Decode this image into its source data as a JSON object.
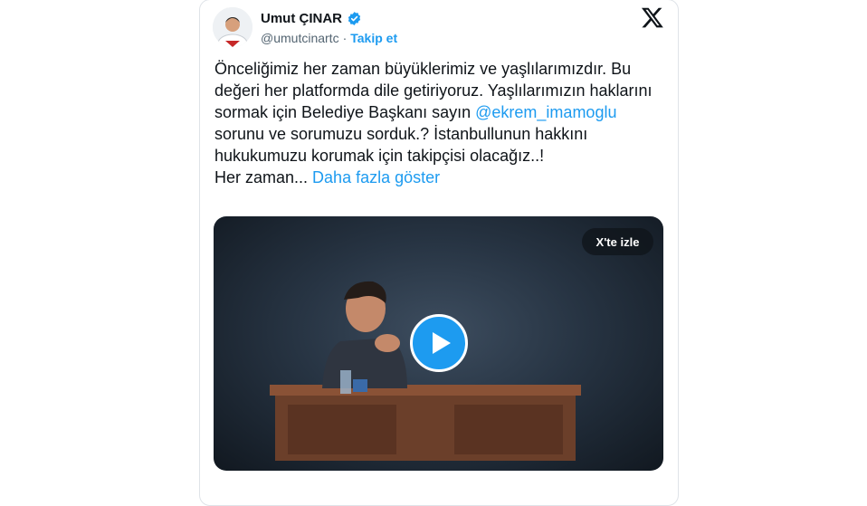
{
  "author": {
    "name": "Umut ÇINAR",
    "handle": "@umutcinartc",
    "separator": "·",
    "follow_label": "Takip et"
  },
  "tweet": {
    "text_before_mention": "Önceliğimiz her zaman büyüklerimiz ve yaşlılarımızdır. Bu değeri her platformda dile getiriyoruz. Yaşlılarımızın haklarını sormak için Belediye Başkanı sayın ",
    "mention": "@ekrem_imamoglu",
    "text_after_mention": " sorunu ve sorumuzu sorduk.? İstanbullunun hakkını hukukumuzu korumak için takipçisi olacağız..!",
    "truncated_line": "Her zaman... ",
    "show_more_label": "Daha fazla göster"
  },
  "media": {
    "watch_on_x_label": "X'te izle"
  },
  "colors": {
    "accent": "#1d9bf0",
    "text": "#0f1419",
    "muted": "#536471"
  },
  "icons": {
    "verified": "verified-badge-icon",
    "logo": "x-logo-icon",
    "play": "play-icon"
  }
}
